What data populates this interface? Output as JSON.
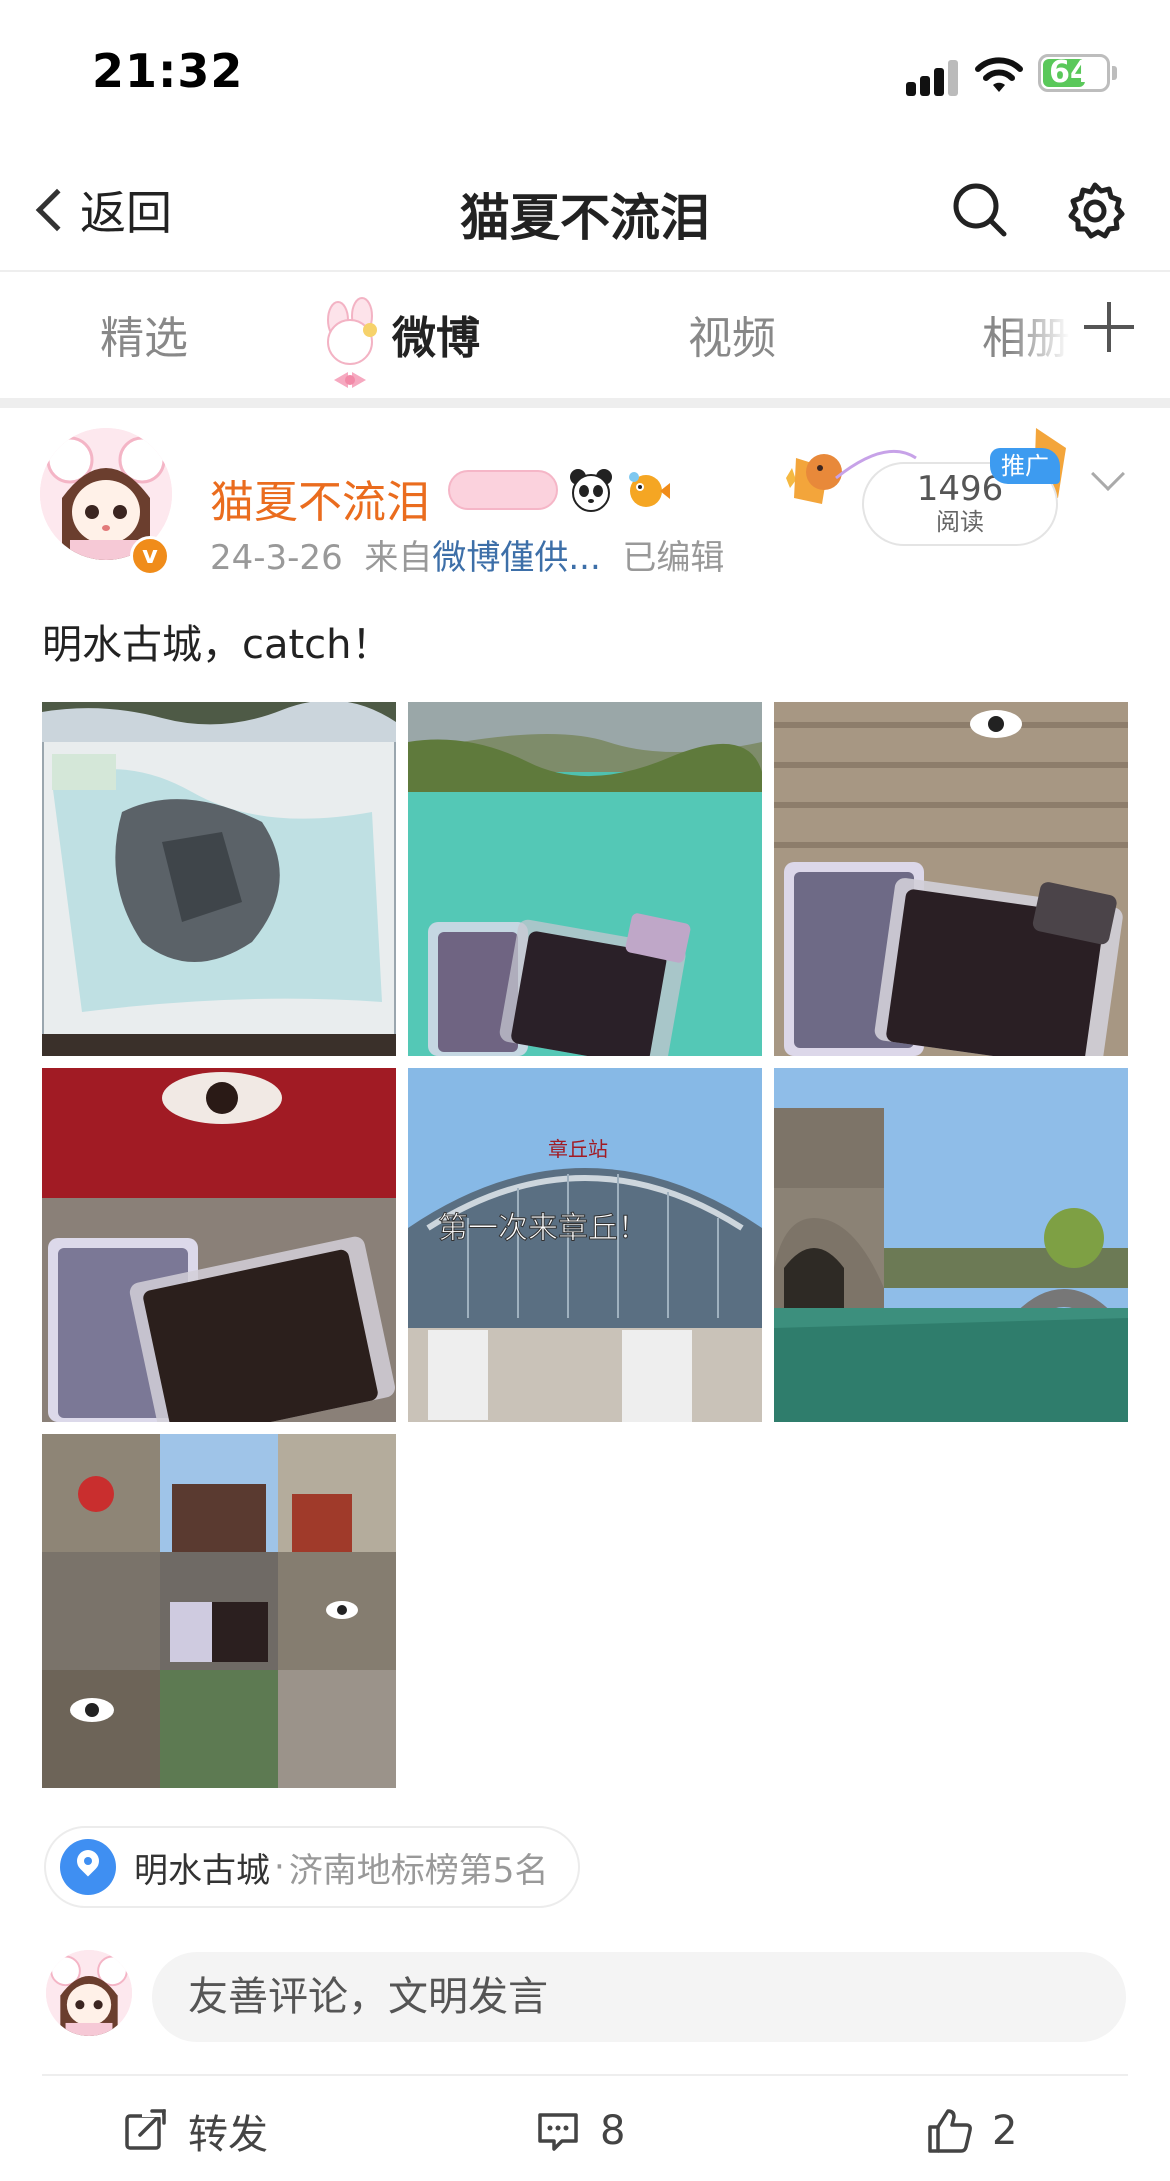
{
  "status_bar": {
    "time": "21:32",
    "battery": "64"
  },
  "nav": {
    "back_label": "返回",
    "title": "猫夏不流泪",
    "search_icon": "search-icon",
    "settings_icon": "gear-icon"
  },
  "tabs": [
    {
      "label": "精选",
      "active": false
    },
    {
      "label": "微博",
      "active": true
    },
    {
      "label": "视频",
      "active": false
    },
    {
      "label": "相册",
      "active": false
    }
  ],
  "post": {
    "username": "猫夏不流泪",
    "date": "24-3-26",
    "source_prefix": "来自",
    "source": "微博僅供...",
    "edited": "已编辑",
    "views": "1496",
    "views_label": "阅读",
    "promo_label": "推广",
    "text": "明水古城，catch！",
    "images": [
      "map-photo",
      "water-photo",
      "wall-card-photo",
      "red-sign-photo",
      "station-photo",
      "canal-photo",
      "collage-photo"
    ],
    "overlay_text": "第一次来章丘！",
    "station_sign": "章丘站"
  },
  "location": {
    "name": "明水古城",
    "separator": "·",
    "rank": "济南地标榜第5名"
  },
  "comment": {
    "placeholder": "友善评论，文明发言"
  },
  "actions": {
    "repost_label": "转发",
    "comments_count": "8",
    "likes_count": "2"
  },
  "colors": {
    "username": "#ea6c1e",
    "source_link": "#3d6fa8",
    "location_icon": "#3f8ff2",
    "verified": "#f08c1a",
    "battery": "#5ac85a"
  }
}
